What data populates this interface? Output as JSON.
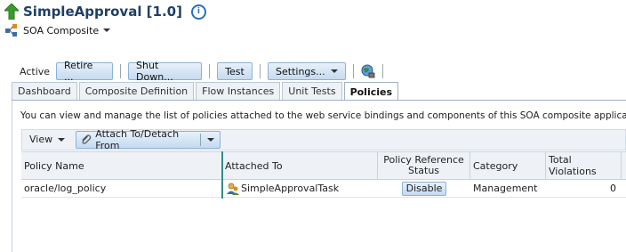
{
  "header": {
    "app_title": "SimpleApproval [1.0]",
    "info_icon": "info-icon",
    "composite_menu_label": "SOA Composite"
  },
  "toolbar": {
    "state_label": "Active",
    "retire_label": "Retire ...",
    "shutdown_label": "Shut Down...",
    "test_label": "Test",
    "settings_label": "Settings..."
  },
  "tabs": [
    {
      "label": "Dashboard",
      "active": false
    },
    {
      "label": "Composite Definition",
      "active": false
    },
    {
      "label": "Flow Instances",
      "active": false
    },
    {
      "label": "Unit Tests",
      "active": false
    },
    {
      "label": "Policies",
      "active": true
    }
  ],
  "policies": {
    "description": "You can view and manage the list of policies attached to the web service bindings and components of this SOA composite application. Click 'Att",
    "view_label": "View",
    "attach_label": "Attach To/Detach From",
    "columns": {
      "policy_name": "Policy Name",
      "attached_to": "Attached To",
      "policy_reference_status": "Policy Reference Status",
      "category": "Category",
      "total_violations": "Total Violations"
    },
    "rows": [
      {
        "policy_name": "oracle/log_policy",
        "attached_to": "SimpleApprovalTask",
        "status_button": "Disable",
        "category": "Management",
        "total_violations": "0"
      }
    ]
  },
  "colors": {
    "title": "#1f3f66",
    "button_border": "#8eb1d6",
    "selection_line": "#2f8c8c"
  }
}
